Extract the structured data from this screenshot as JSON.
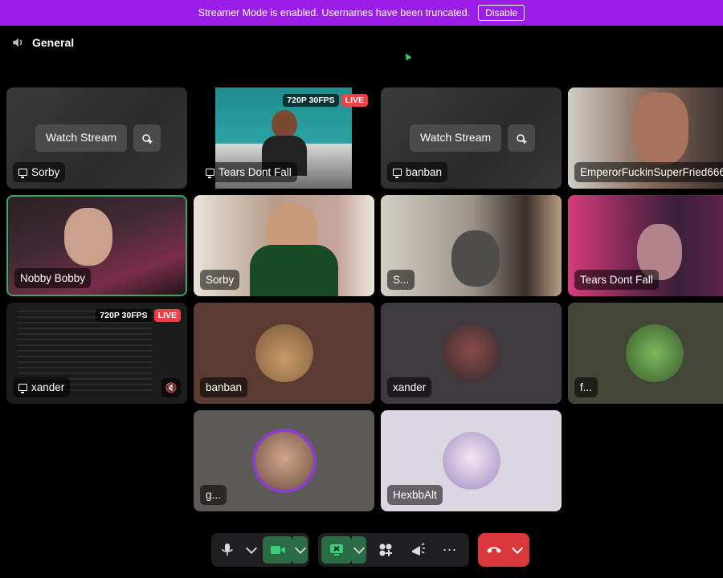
{
  "banner": {
    "message": "Streamer Mode is enabled. Usernames have been truncated.",
    "disable_label": "Disable"
  },
  "channel": {
    "name": "General"
  },
  "tiles": [
    {
      "name": "Sorby",
      "watch_label": "Watch Stream"
    },
    {
      "name": "Tears Dont Fall",
      "quality": "720P 30FPS",
      "live": "LIVE"
    },
    {
      "name": "banban",
      "watch_label": "Watch Stream"
    },
    {
      "name": "EmperorFuckinSuperFried666"
    },
    {
      "name": "Nobby Bobby"
    },
    {
      "name": "Sorby"
    },
    {
      "name": "S..."
    },
    {
      "name": "Tears Dont Fall"
    },
    {
      "name": "xander",
      "quality": "720P 30FPS",
      "live": "LIVE"
    },
    {
      "name": "banban"
    },
    {
      "name": "xander"
    },
    {
      "name": "f..."
    },
    {
      "name": "g..."
    },
    {
      "name": "HexbbAlt"
    }
  ],
  "colors": {
    "banner": "#9b1ee8",
    "live": "#ed4245",
    "speaking": "#3ba55d",
    "hangup": "#da373c",
    "camera_on": "#2b6b45"
  }
}
